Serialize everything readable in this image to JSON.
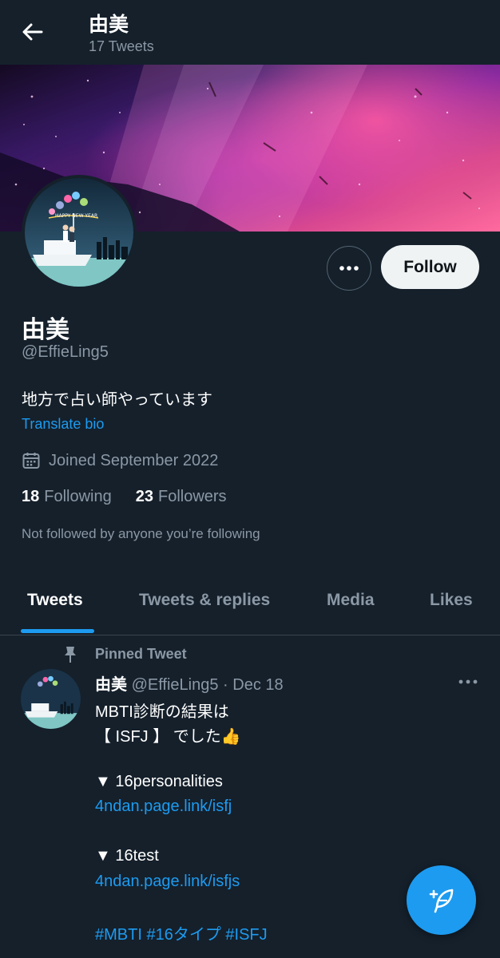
{
  "header": {
    "title": "由美",
    "subtitle": "17 Tweets"
  },
  "profile": {
    "name": "由美",
    "handle": "@EffieLing5",
    "bio": "地方で占い師やっています",
    "translate_label": "Translate bio",
    "joined": "Joined September 2022",
    "following_count": "18",
    "following_label": "Following",
    "followers_count": "23",
    "followers_label": "Followers",
    "not_followed_note": "Not followed by anyone you’re following",
    "avatar_banner_text": "HAPPY NEW YEAR"
  },
  "actions": {
    "follow_label": "Follow",
    "more_icon": "more-horizontal-icon"
  },
  "tabs": [
    {
      "label": "Tweets",
      "active": true
    },
    {
      "label": "Tweets & replies",
      "active": false
    },
    {
      "label": "Media",
      "active": false
    },
    {
      "label": "Likes",
      "active": false
    }
  ],
  "pinned_tweet": {
    "pinned_label": "Pinned Tweet",
    "author_name": "由美",
    "author_handle": "@EffieLing5",
    "separator": "·",
    "date": "Dec 18",
    "lines": {
      "l1": "MBTI診断の結果は",
      "l2": "【 ISFJ 】 でした👍",
      "l3": "▼ 16personalities",
      "l4": "4ndan.page.link/isfj",
      "l5": "▼ 16test",
      "l6": "4ndan.page.link/isfjs",
      "hashtag1": "#MBTI",
      "hashtag2": "#16タイプ",
      "hashtag3": "#ISFJ"
    }
  },
  "colors": {
    "background": "#15202b",
    "accent": "#1d9bf0",
    "muted_text": "#8b98a5",
    "follow_button": "#eff3f4"
  }
}
